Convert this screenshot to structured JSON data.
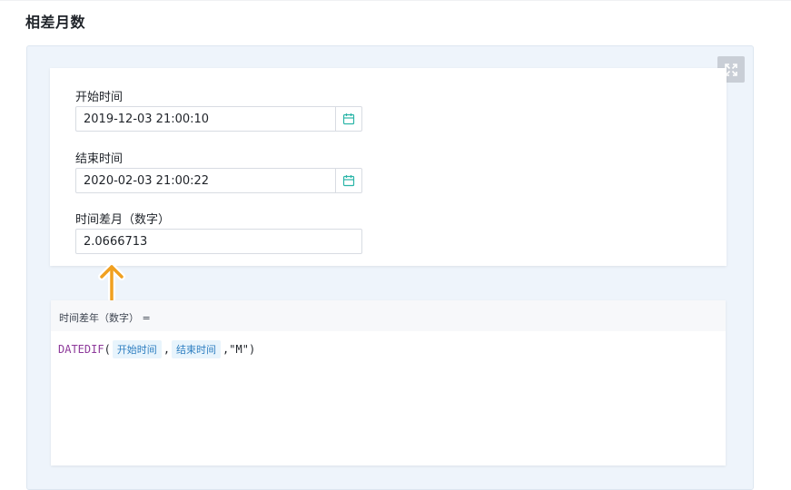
{
  "page": {
    "title": "相差月数"
  },
  "form": {
    "start_label": "开始时间",
    "start_value": "2019-12-03 21:00:10",
    "end_label": "结束时间",
    "end_value": "2020-02-03 21:00:22",
    "result_label": "时间差月（数字）",
    "result_value": "2.0666713"
  },
  "formula": {
    "label": "时间差年（数字） =",
    "function_name": "DATEDIF",
    "open_paren": "(",
    "ref1": "开始时间",
    "separator1": ",",
    "ref2": "结束时间",
    "tail": ",\"M\")"
  },
  "icons": {
    "expand": "expand-icon",
    "calendar": "calendar-icon",
    "arrow": "arrow-up-icon"
  },
  "colors": {
    "accent": "#2bb5a8",
    "arrow": "#f0a020",
    "function": "#8e3a9b",
    "reference": "#2f7fc1"
  }
}
